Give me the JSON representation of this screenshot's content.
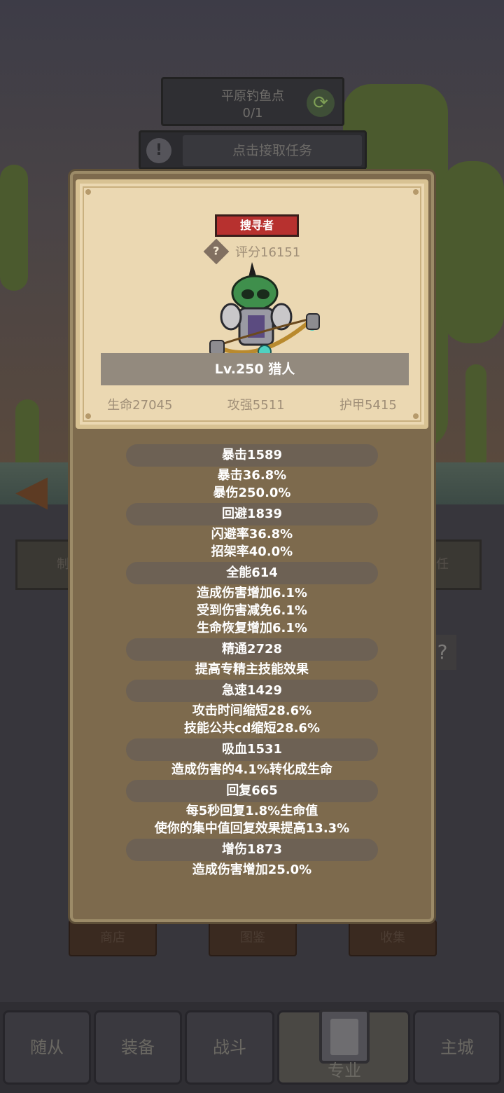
{
  "background": {
    "quest": {
      "title": "平原钓鱼点",
      "progress": "0/1"
    },
    "task_button": "点击接取任务",
    "side_tabs": [
      "制",
      "任"
    ],
    "sub_buttons": [
      "商店",
      "图鉴",
      "收集"
    ]
  },
  "nav": {
    "tabs": [
      {
        "label": "随从",
        "active": false
      },
      {
        "label": "装备",
        "active": false
      },
      {
        "label": "战斗",
        "active": false
      },
      {
        "label": "专业",
        "active": true
      },
      {
        "label": "主城",
        "active": false
      }
    ]
  },
  "modal": {
    "class_tag": "搜寻者",
    "score": "评分16151",
    "level_title": "Lv.250 猎人",
    "base_stats": [
      "生命27045",
      "攻强5511",
      "护甲5415"
    ],
    "stat_groups": [
      {
        "header": "暴击1589",
        "lines": [
          "暴击36.8%",
          "暴伤250.0%"
        ]
      },
      {
        "header": "回避1839",
        "lines": [
          "闪避率36.8%",
          "招架率40.0%"
        ]
      },
      {
        "header": "全能614",
        "lines": [
          "造成伤害增加6.1%",
          "受到伤害减免6.1%",
          "生命恢复增加6.1%"
        ]
      },
      {
        "header": "精通2728",
        "lines": [
          "提高专精主技能效果"
        ]
      },
      {
        "header": "急速1429",
        "lines": [
          "攻击时间缩短28.6%",
          "技能公共cd缩短28.6%"
        ]
      },
      {
        "header": "吸血1531",
        "lines": [
          "造成伤害的4.1%转化成生命"
        ]
      },
      {
        "header": "回复665",
        "lines": [
          "每5秒回复1.8%生命值",
          "使你的集中值回复效果提高13.3%"
        ]
      },
      {
        "header": "增伤1873",
        "lines": [
          "造成伤害增加25.0%"
        ]
      }
    ]
  },
  "colors": {
    "parchment": "#ebd8b2",
    "panel": "#7d6a4d",
    "class_tag": "#b7312f",
    "stat_pill": "#6d6154"
  }
}
